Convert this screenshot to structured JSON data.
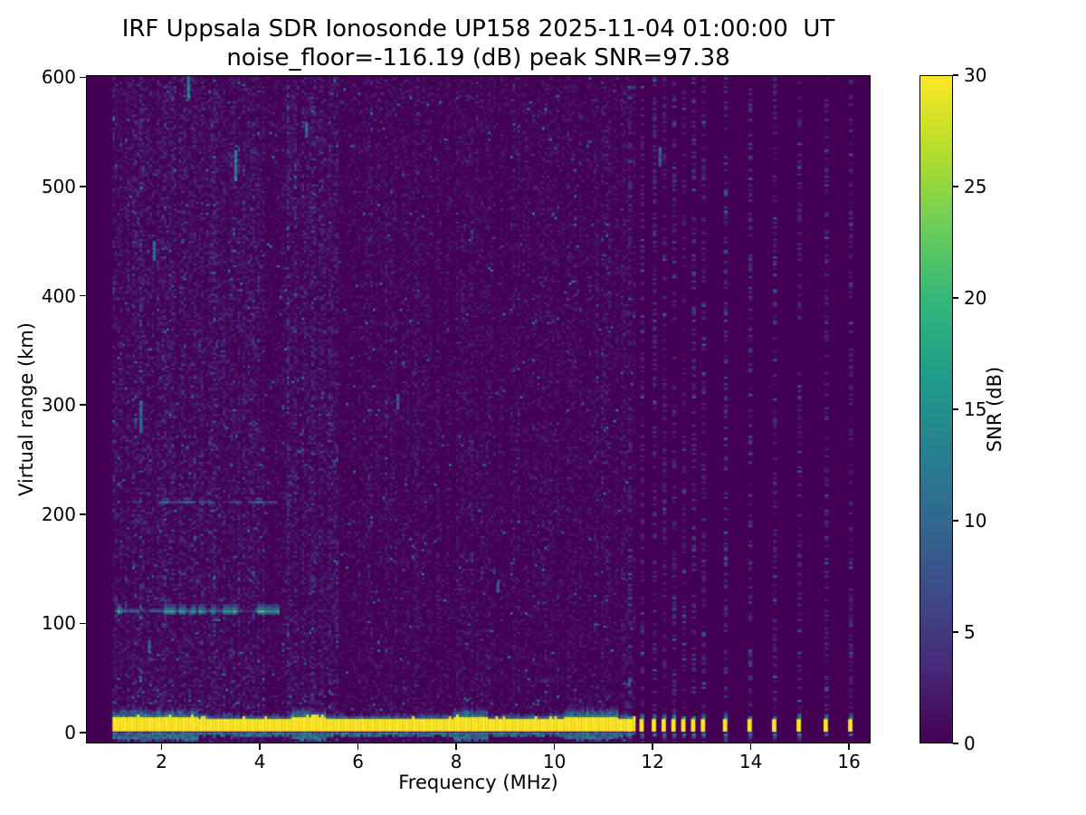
{
  "title": {
    "line1": "IRF Uppsala SDR Ionosonde UP158 2025-11-04 01:00:00  UT",
    "line2": "noise_floor=-116.19 (dB) peak SNR=97.38"
  },
  "chart_data": {
    "type": "heatmap",
    "title": "IRF Uppsala SDR Ionosonde UP158 2025-11-04 01:00:00  UT",
    "subtitle": "noise_floor=-116.19 (dB) peak SNR=97.38",
    "xlabel": "Frequency (MHz)",
    "ylabel": "Virtual range (km)",
    "xlim": [
      0.46,
      16.44
    ],
    "ylim": [
      -10,
      602
    ],
    "xticks": [
      2,
      4,
      6,
      8,
      10,
      12,
      14,
      16
    ],
    "yticks": [
      0,
      100,
      200,
      300,
      400,
      500,
      600
    ],
    "noise_floor_db": -116.19,
    "peak_snr_db": 97.38,
    "colorbar": {
      "label": "SNR (dB)",
      "min": 0,
      "max": 30,
      "ticks": [
        0,
        5,
        10,
        15,
        20,
        25,
        30
      ],
      "colormap": "viridis",
      "colormap_stops": [
        "#440154",
        "#482878",
        "#3e4a89",
        "#31688e",
        "#26828e",
        "#1f9e89",
        "#35b779",
        "#6ece58",
        "#b5de2b",
        "#fde725"
      ]
    },
    "features": {
      "background_db": 0,
      "sweep": {
        "f_start": 1.0,
        "f_end": 11.62,
        "f_step": 0.05,
        "range_step_km": 2
      },
      "discrete_freqs": [
        11.5,
        11.75,
        12.0,
        12.2,
        12.4,
        12.6,
        12.8,
        13.0,
        13.45,
        13.95,
        14.45,
        14.95,
        15.5,
        16.0
      ],
      "quiet_band": [
        3.95,
        4.42
      ],
      "noise": {
        "amp_low": 1.1,
        "amp_high": 0.75,
        "split_freq": 5.5,
        "boost_every_mhz": 0.5,
        "boost_factor": 1.7,
        "teal_prob": 0.005
      },
      "ground_pulse": {
        "core_range_km": [
          1,
          12.5
        ],
        "peak_db": 30,
        "fringe_top_km": 22,
        "fringe_bottom_km": -6,
        "bright_segments": [
          [
            1.0,
            2.7
          ],
          [
            4.6,
            5.3
          ],
          [
            7.9,
            8.6
          ],
          [
            10.2,
            11.3
          ]
        ]
      },
      "echoes": [
        {
          "range_km": 111,
          "f_start": 1.05,
          "f_end": 4.35,
          "db": 9,
          "bright_freqs": [
            1.12,
            2.08,
            2.2,
            2.38,
            2.62,
            2.78,
            3.02,
            3.28,
            3.46,
            3.98,
            4.15,
            4.28
          ],
          "bright_db": 19,
          "gaps": [
            [
              1.55,
              1.72
            ],
            [
              3.62,
              3.85
            ]
          ]
        },
        {
          "range_km": 211,
          "db": 7,
          "segments": [
            [
              1.45,
              1.6
            ],
            [
              1.95,
              2.65
            ],
            [
              2.75,
              3.0
            ],
            [
              3.35,
              3.62
            ],
            [
              3.8,
              4.3
            ]
          ],
          "bright_freqs": [
            2.05,
            2.5,
            3.95
          ],
          "bright_db": 13
        }
      ],
      "streaks": [
        {
          "f": 2.52,
          "range_km": 592,
          "len_km": 22,
          "db": 15
        },
        {
          "f": 3.48,
          "range_km": 520,
          "len_km": 28,
          "db": 15
        },
        {
          "f": 1.82,
          "range_km": 442,
          "len_km": 18,
          "db": 11
        },
        {
          "f": 1.55,
          "range_km": 290,
          "len_km": 30,
          "db": 11
        },
        {
          "f": 4.92,
          "range_km": 553,
          "len_km": 14,
          "db": 11
        },
        {
          "f": 6.78,
          "range_km": 304,
          "len_km": 14,
          "db": 10
        },
        {
          "f": 12.12,
          "range_km": 528,
          "len_km": 18,
          "db": 9
        },
        {
          "f": 1.72,
          "range_km": 80,
          "len_km": 12,
          "db": 11
        },
        {
          "f": 8.82,
          "range_km": 134,
          "len_km": 10,
          "db": 10
        }
      ]
    }
  }
}
